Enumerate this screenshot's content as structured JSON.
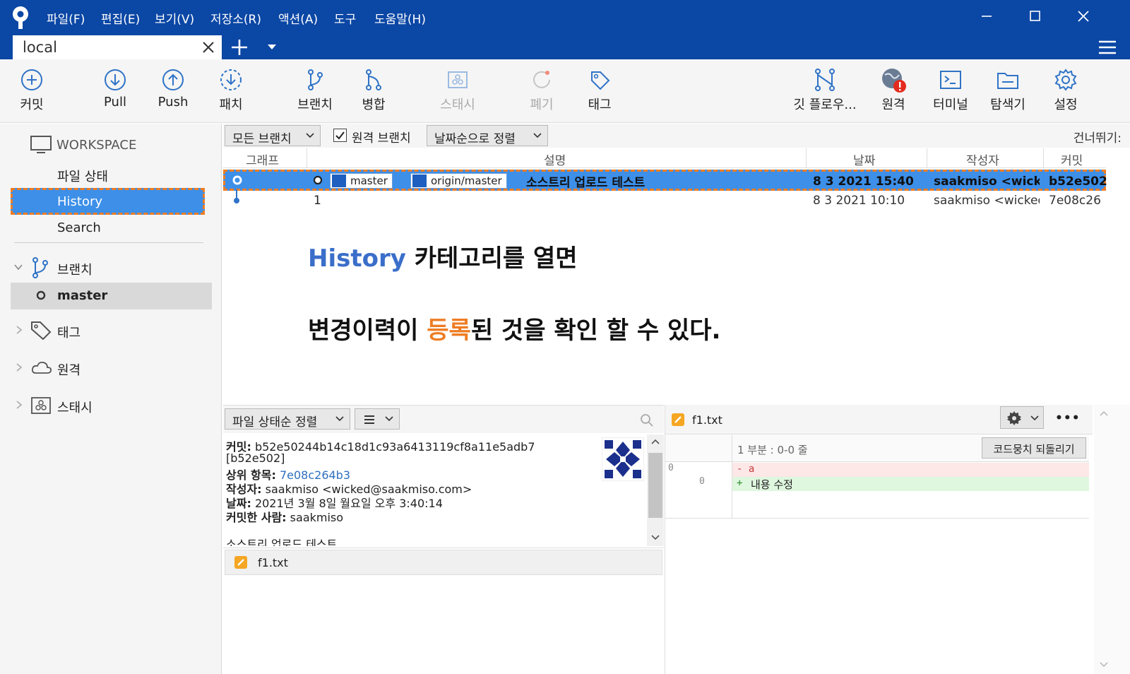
{
  "titlebar": {
    "menu": [
      "파일(F)",
      "편집(E)",
      "보기(V)",
      "저장소(R)",
      "액션(A)",
      "도구",
      "도움말(H)"
    ]
  },
  "tabs": {
    "active_tab": "local"
  },
  "toolbar": {
    "commit": "커밋",
    "pull": "Pull",
    "push": "Push",
    "patch": "패치",
    "branch": "브랜치",
    "merge": "병합",
    "stash": "스태시",
    "discard": "폐기",
    "tag": "태그",
    "gitflow": "깃 플로우...",
    "remote": "원격",
    "terminal": "터미널",
    "explorer": "탐색기",
    "settings": "설정"
  },
  "sidebar": {
    "workspace": "WORKSPACE",
    "file_status": "파일 상태",
    "history": "History",
    "search": "Search",
    "branches": "브랜치",
    "master": "master",
    "tags": "태그",
    "remotes": "원격",
    "stashes": "스태시"
  },
  "filters": {
    "all_branches": "모든 브랜치",
    "remote_branches": "원격 브랜치",
    "remote_branches_checked": true,
    "sort": "날짜순으로 정렬",
    "jump": "건너뛰기:"
  },
  "commit_list": {
    "headers": {
      "graph": "그래프",
      "description": "설명",
      "date": "날짜",
      "author": "작성자",
      "commit": "커밋"
    },
    "rows": [
      {
        "refs": [
          "master",
          "origin/master"
        ],
        "description": "소스트리 업로드 테스트",
        "date": "8 3 2021 15:40",
        "author": "saakmiso <wicked",
        "commit": "b52e502"
      },
      {
        "description": "1",
        "date": "8 3 2021 10:10",
        "author": "saakmiso <wicked",
        "commit": "7e08c26"
      }
    ]
  },
  "annotation": {
    "line1_highlight": "History",
    "line1_rest": " 카테고리를 열면",
    "line2_a": "변경이력이 ",
    "line2_highlight": "등록",
    "line2_b": "된 것을 확인 할 수 있다."
  },
  "lower": {
    "sort": "파일 상태순 정렬",
    "view_icon": "list-icon"
  },
  "commit_detail": {
    "commit_label": "커밋:",
    "commit_hash": "b52e50244b14c18d1c93a6413119cf8a11e5adb7",
    "commit_short": "[b52e502]",
    "parent_label": "상위 항목:",
    "parent_hash": "7e08c264b3",
    "author_label": "작성자:",
    "author": "saakmiso <wicked@saakmiso.com>",
    "date_label": "날짜:",
    "date": "2021년 3월 8일 월요일 오후 3:40:14",
    "committer_label": "커밋한 사람:",
    "committer": "saakmiso",
    "message": "소스트리 업로드 테스트"
  },
  "files": [
    "f1.txt"
  ],
  "diff": {
    "file": "f1.txt",
    "hunk": "1 부분 : 0-0 줄",
    "revert_button": "코드뭉치 되돌리기",
    "old_line_no": "0",
    "new_line_no": "0",
    "del_marker": "- a",
    "add_marker": "+",
    "add_text": "내용 수정",
    "more": "•••"
  },
  "colors": {
    "titlebar": "#0b47a5",
    "selection": "#3d8fe8",
    "annotation_orange": "#ee7d24",
    "annotation_blue": "#3a6ec9"
  }
}
